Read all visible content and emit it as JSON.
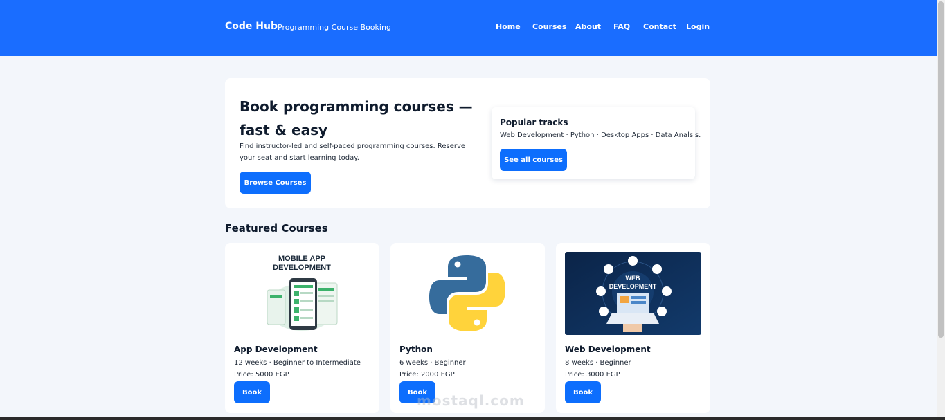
{
  "header": {
    "brand": "Code Hub",
    "tagline": "Programming Course Booking",
    "nav": [
      "Home",
      "Courses",
      "About",
      "FAQ",
      "Contact",
      "Login"
    ]
  },
  "hero": {
    "title": "Book programming courses — fast & easy",
    "description": "Find instructor-led and self-paced programming courses. Reserve your seat and start learning today.",
    "browse_label": "Browse Courses",
    "tracks_title": "Popular tracks",
    "tracks_list": "Web Development · Python · Desktop Apps · Data Analsis.",
    "see_all_label": "See all courses"
  },
  "featured": {
    "title": "Featured Courses",
    "cards": [
      {
        "title": "App Development",
        "meta": "12 weeks · Beginner to Intermediate",
        "price": "Price: 5000 EGP",
        "book_label": "Book",
        "image_caption": "MOBILE APP DEVELOPMENT",
        "image_icon": "mobile-app-illustration"
      },
      {
        "title": "Python",
        "meta": "6 weeks · Beginner",
        "price": "Price: 2000 EGP",
        "book_label": "Book",
        "image_icon": "python-logo"
      },
      {
        "title": "Web Development",
        "meta": "8 weeks · Beginner",
        "price": "Price: 3000 EGP",
        "book_label": "Book",
        "image_caption": "WEB DEVELOPMENT",
        "image_icon": "web-development-illustration"
      }
    ]
  },
  "watermark": {
    "text": "mostaql.com"
  },
  "colors": {
    "primary": "#1a6dff",
    "button": "#0d6efd",
    "background": "#f3f6fb"
  }
}
